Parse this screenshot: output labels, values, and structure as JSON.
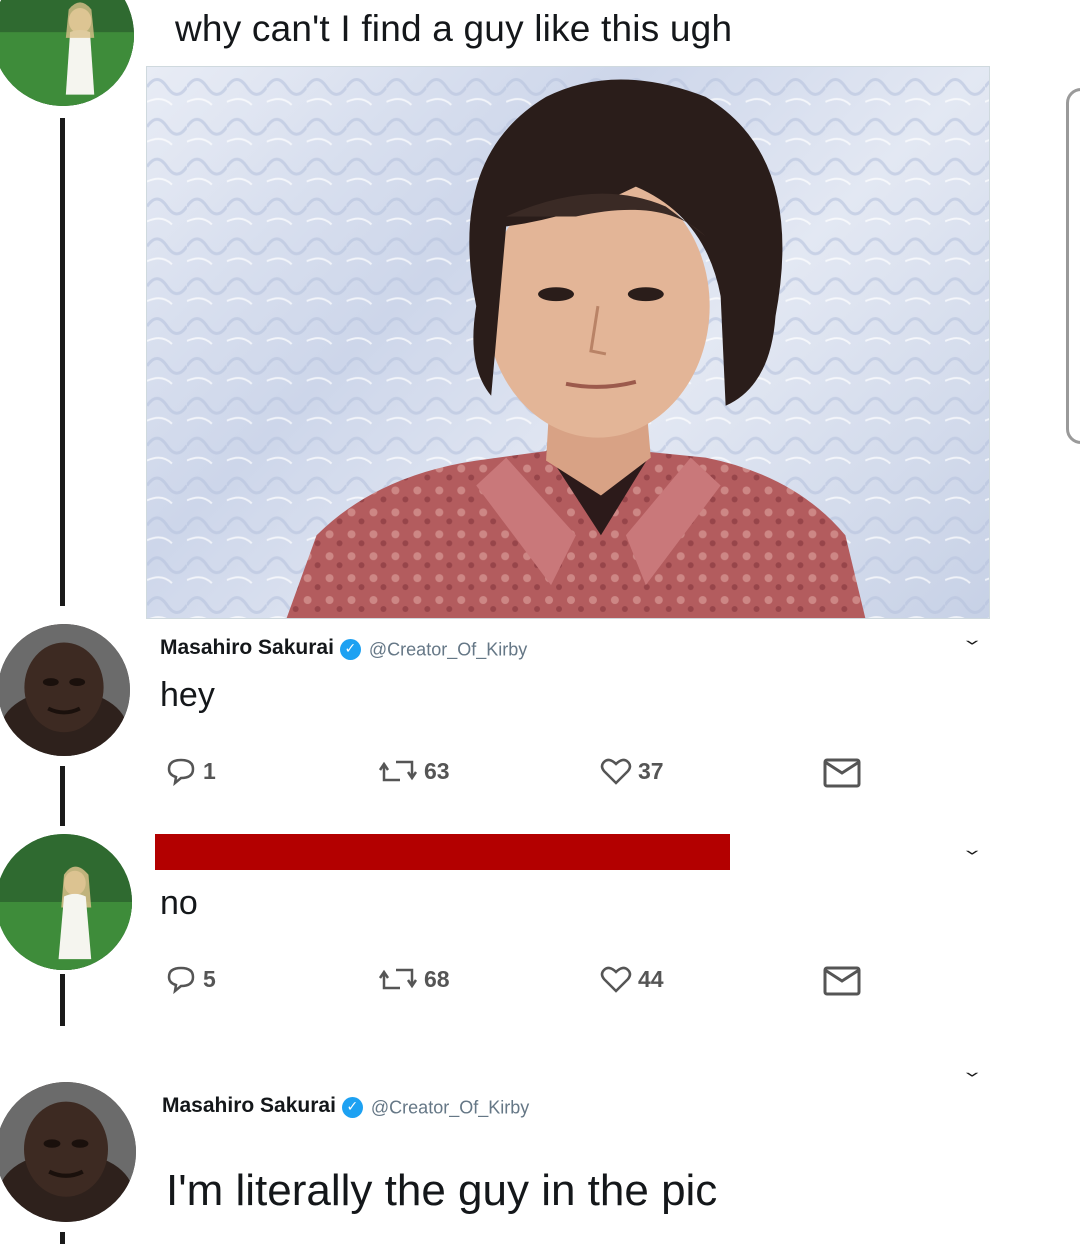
{
  "top_tweet": {
    "text": "why can't I find a guy like this ugh"
  },
  "reply1": {
    "name": "Masahiro Sakurai",
    "handle": "@Creator_Of_Kirby",
    "text": "hey",
    "reply_count": "1",
    "retweet_count": "63",
    "like_count": "37"
  },
  "reply2": {
    "text": "no",
    "reply_count": "5",
    "retweet_count": "68",
    "like_count": "44",
    "name_redacted_color": "#b30000"
  },
  "reply3": {
    "name": "Masahiro Sakurai",
    "handle": "@Creator_Of_Kirby",
    "text": "I'm literally the guy in the pic"
  },
  "icons": {
    "reply": "reply-icon",
    "retweet": "retweet-icon",
    "like": "heart-icon",
    "dm": "envelope-icon",
    "verified": "verified-badge-icon",
    "chevron": "chevron-down-icon"
  },
  "colors": {
    "verified": "#1da1f2",
    "handle": "#657786",
    "redaction": "#b30000"
  }
}
